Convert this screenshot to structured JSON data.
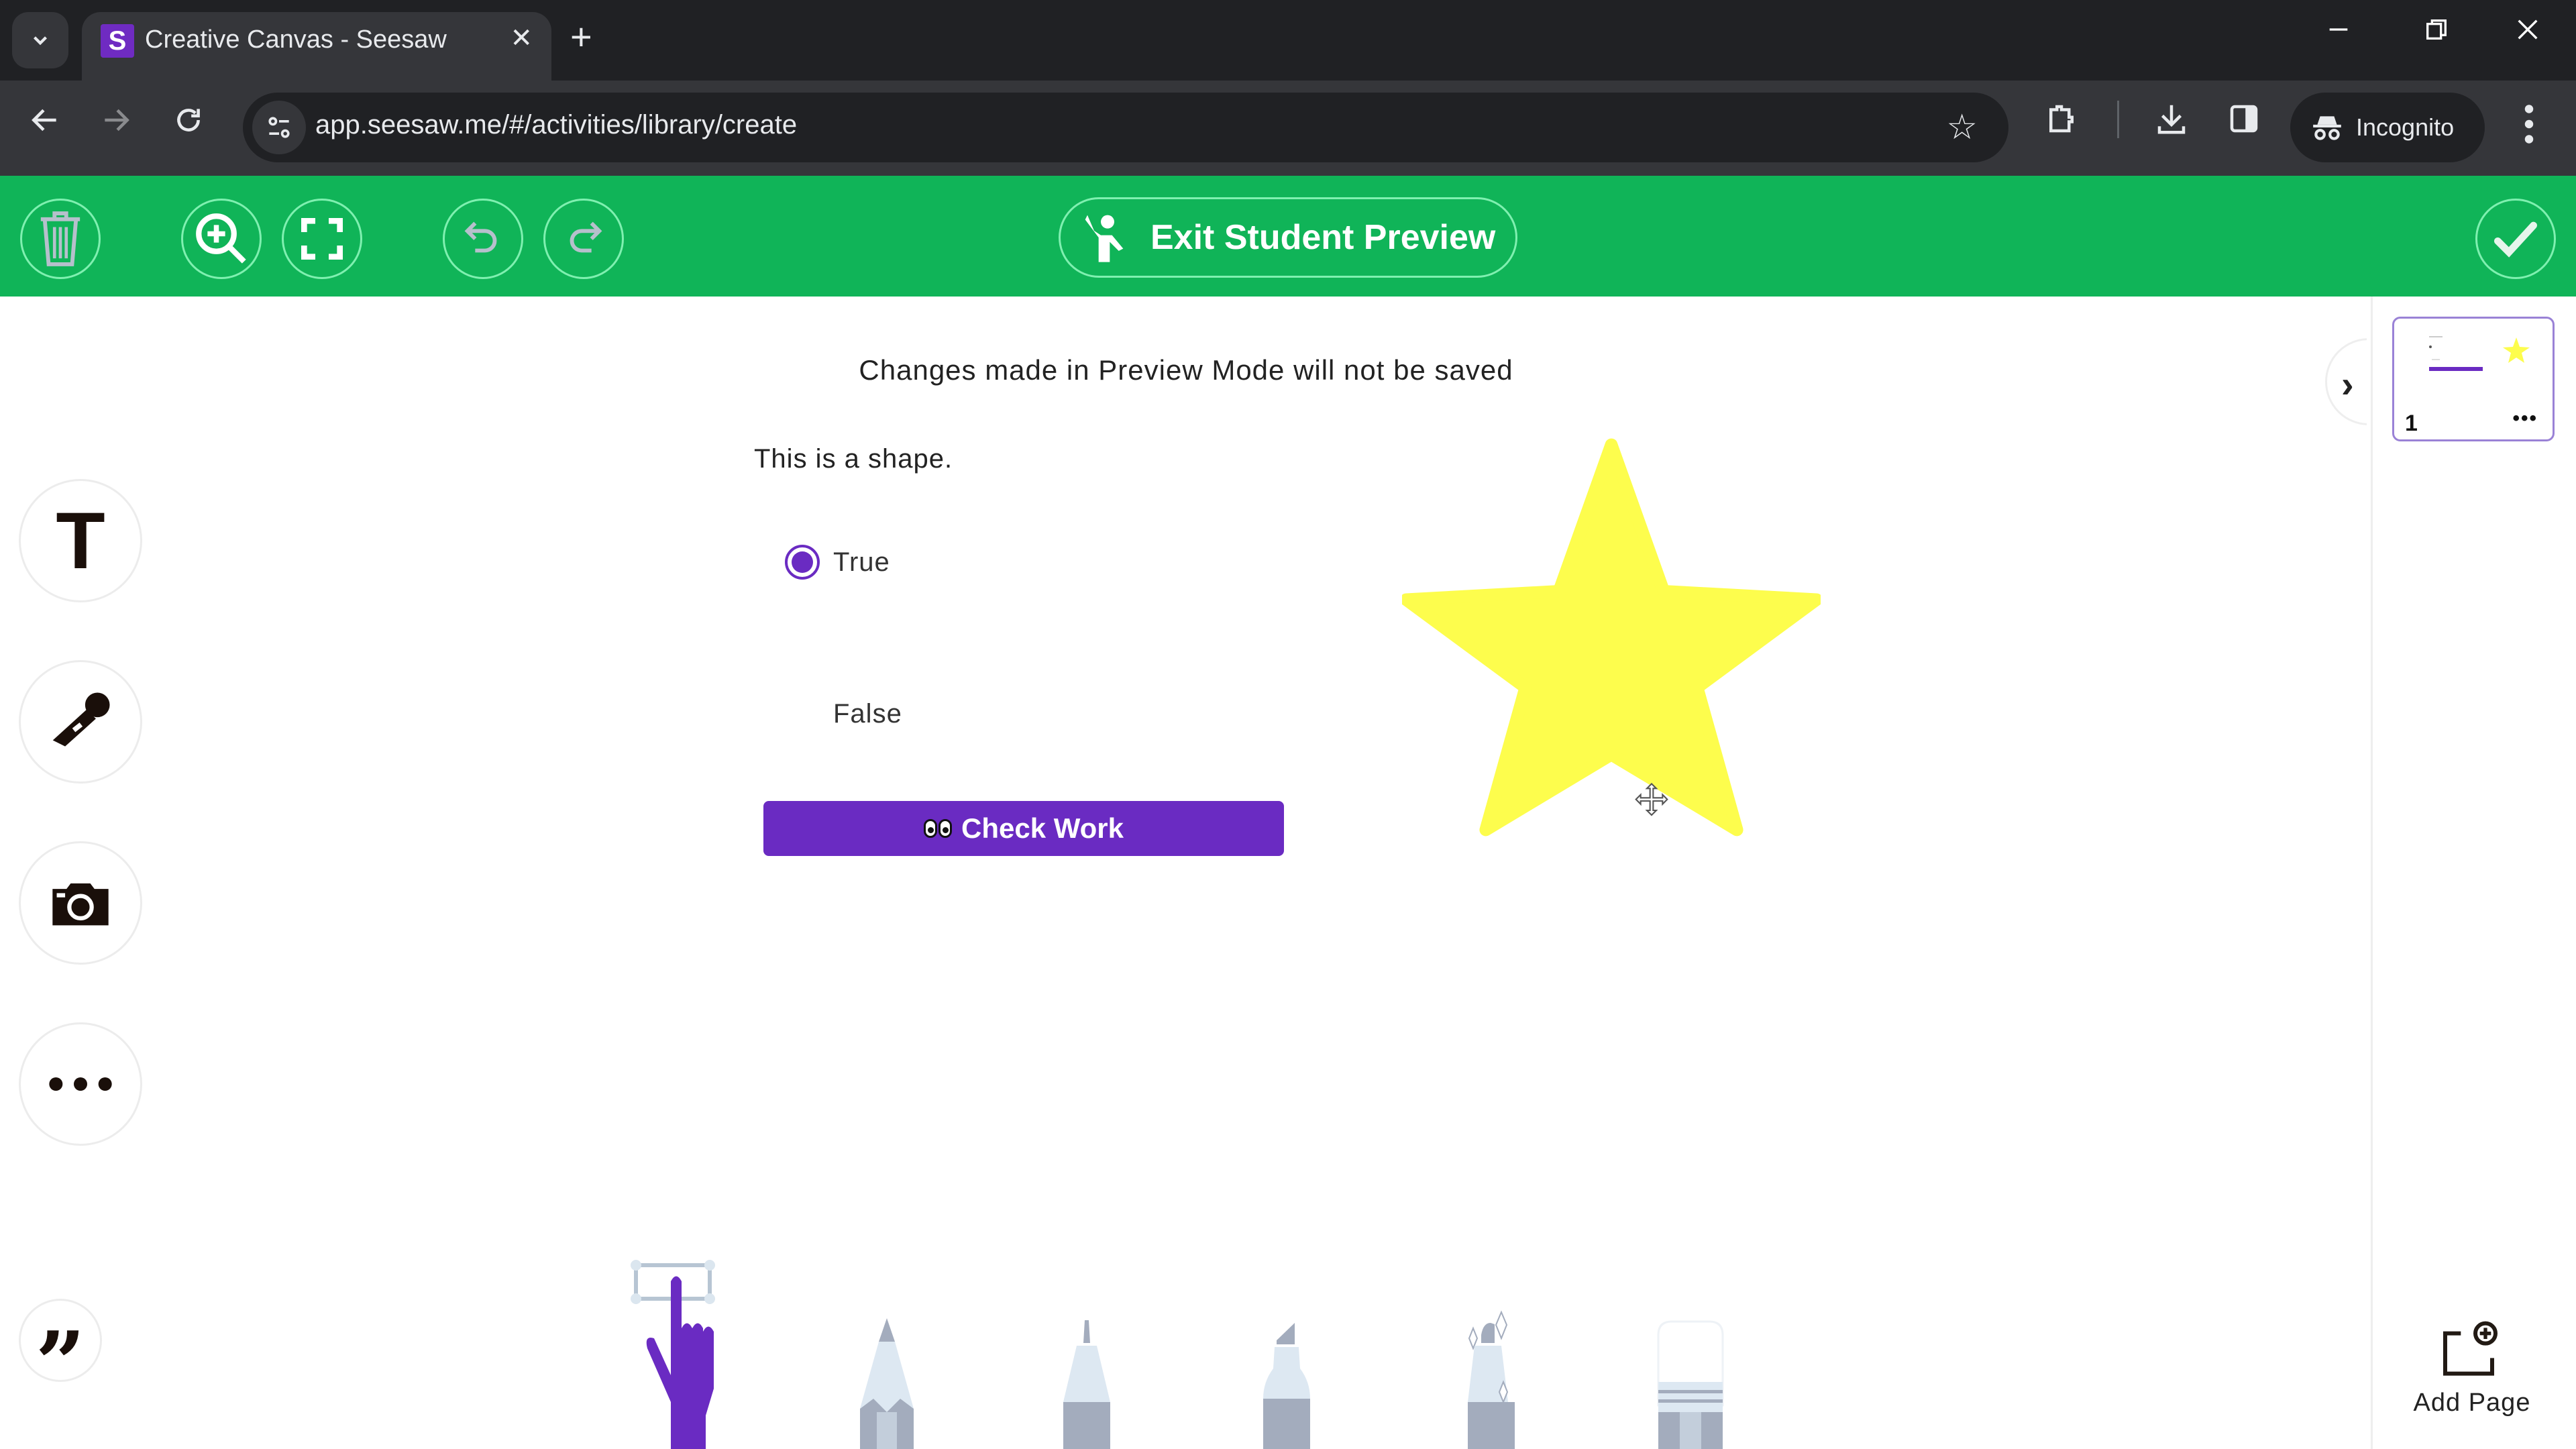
{
  "browser": {
    "tab": {
      "title": "Creative Canvas - Seesaw",
      "favicon_letter": "S"
    },
    "url": "app.seesaw.me/#/activities/library/create",
    "profile_label": "Incognito"
  },
  "toolbar": {
    "exit_preview_label": "Exit Student Preview",
    "buttons": [
      "trash-icon",
      "zoom-in-icon",
      "fullscreen-icon",
      "undo-icon",
      "redo-icon",
      "checkmark-icon"
    ]
  },
  "canvas": {
    "preview_notice": "Changes made in Preview Mode will not be saved",
    "question": "This is a shape.",
    "options": [
      {
        "label": "True",
        "selected": true
      },
      {
        "label": "False",
        "selected": false
      }
    ],
    "check_work_label": "Check Work",
    "shape": {
      "type": "star",
      "color": "#fdfd4d"
    }
  },
  "sidebar": {
    "tools": [
      "text-tool",
      "microphone-tool",
      "camera-tool",
      "more-tool",
      "quote-tool"
    ],
    "text_glyph": "T"
  },
  "pages": {
    "items": [
      {
        "number": "1",
        "menu": "•••"
      }
    ],
    "add_page_label": "Add Page"
  },
  "drawing_tools": [
    "hand-select",
    "pencil",
    "pen",
    "marker",
    "glitter-pen",
    "eraser"
  ],
  "colors": {
    "brand_green": "#10b458",
    "accent_purple": "#6a2bc2",
    "star_yellow": "#fdfd4d"
  }
}
